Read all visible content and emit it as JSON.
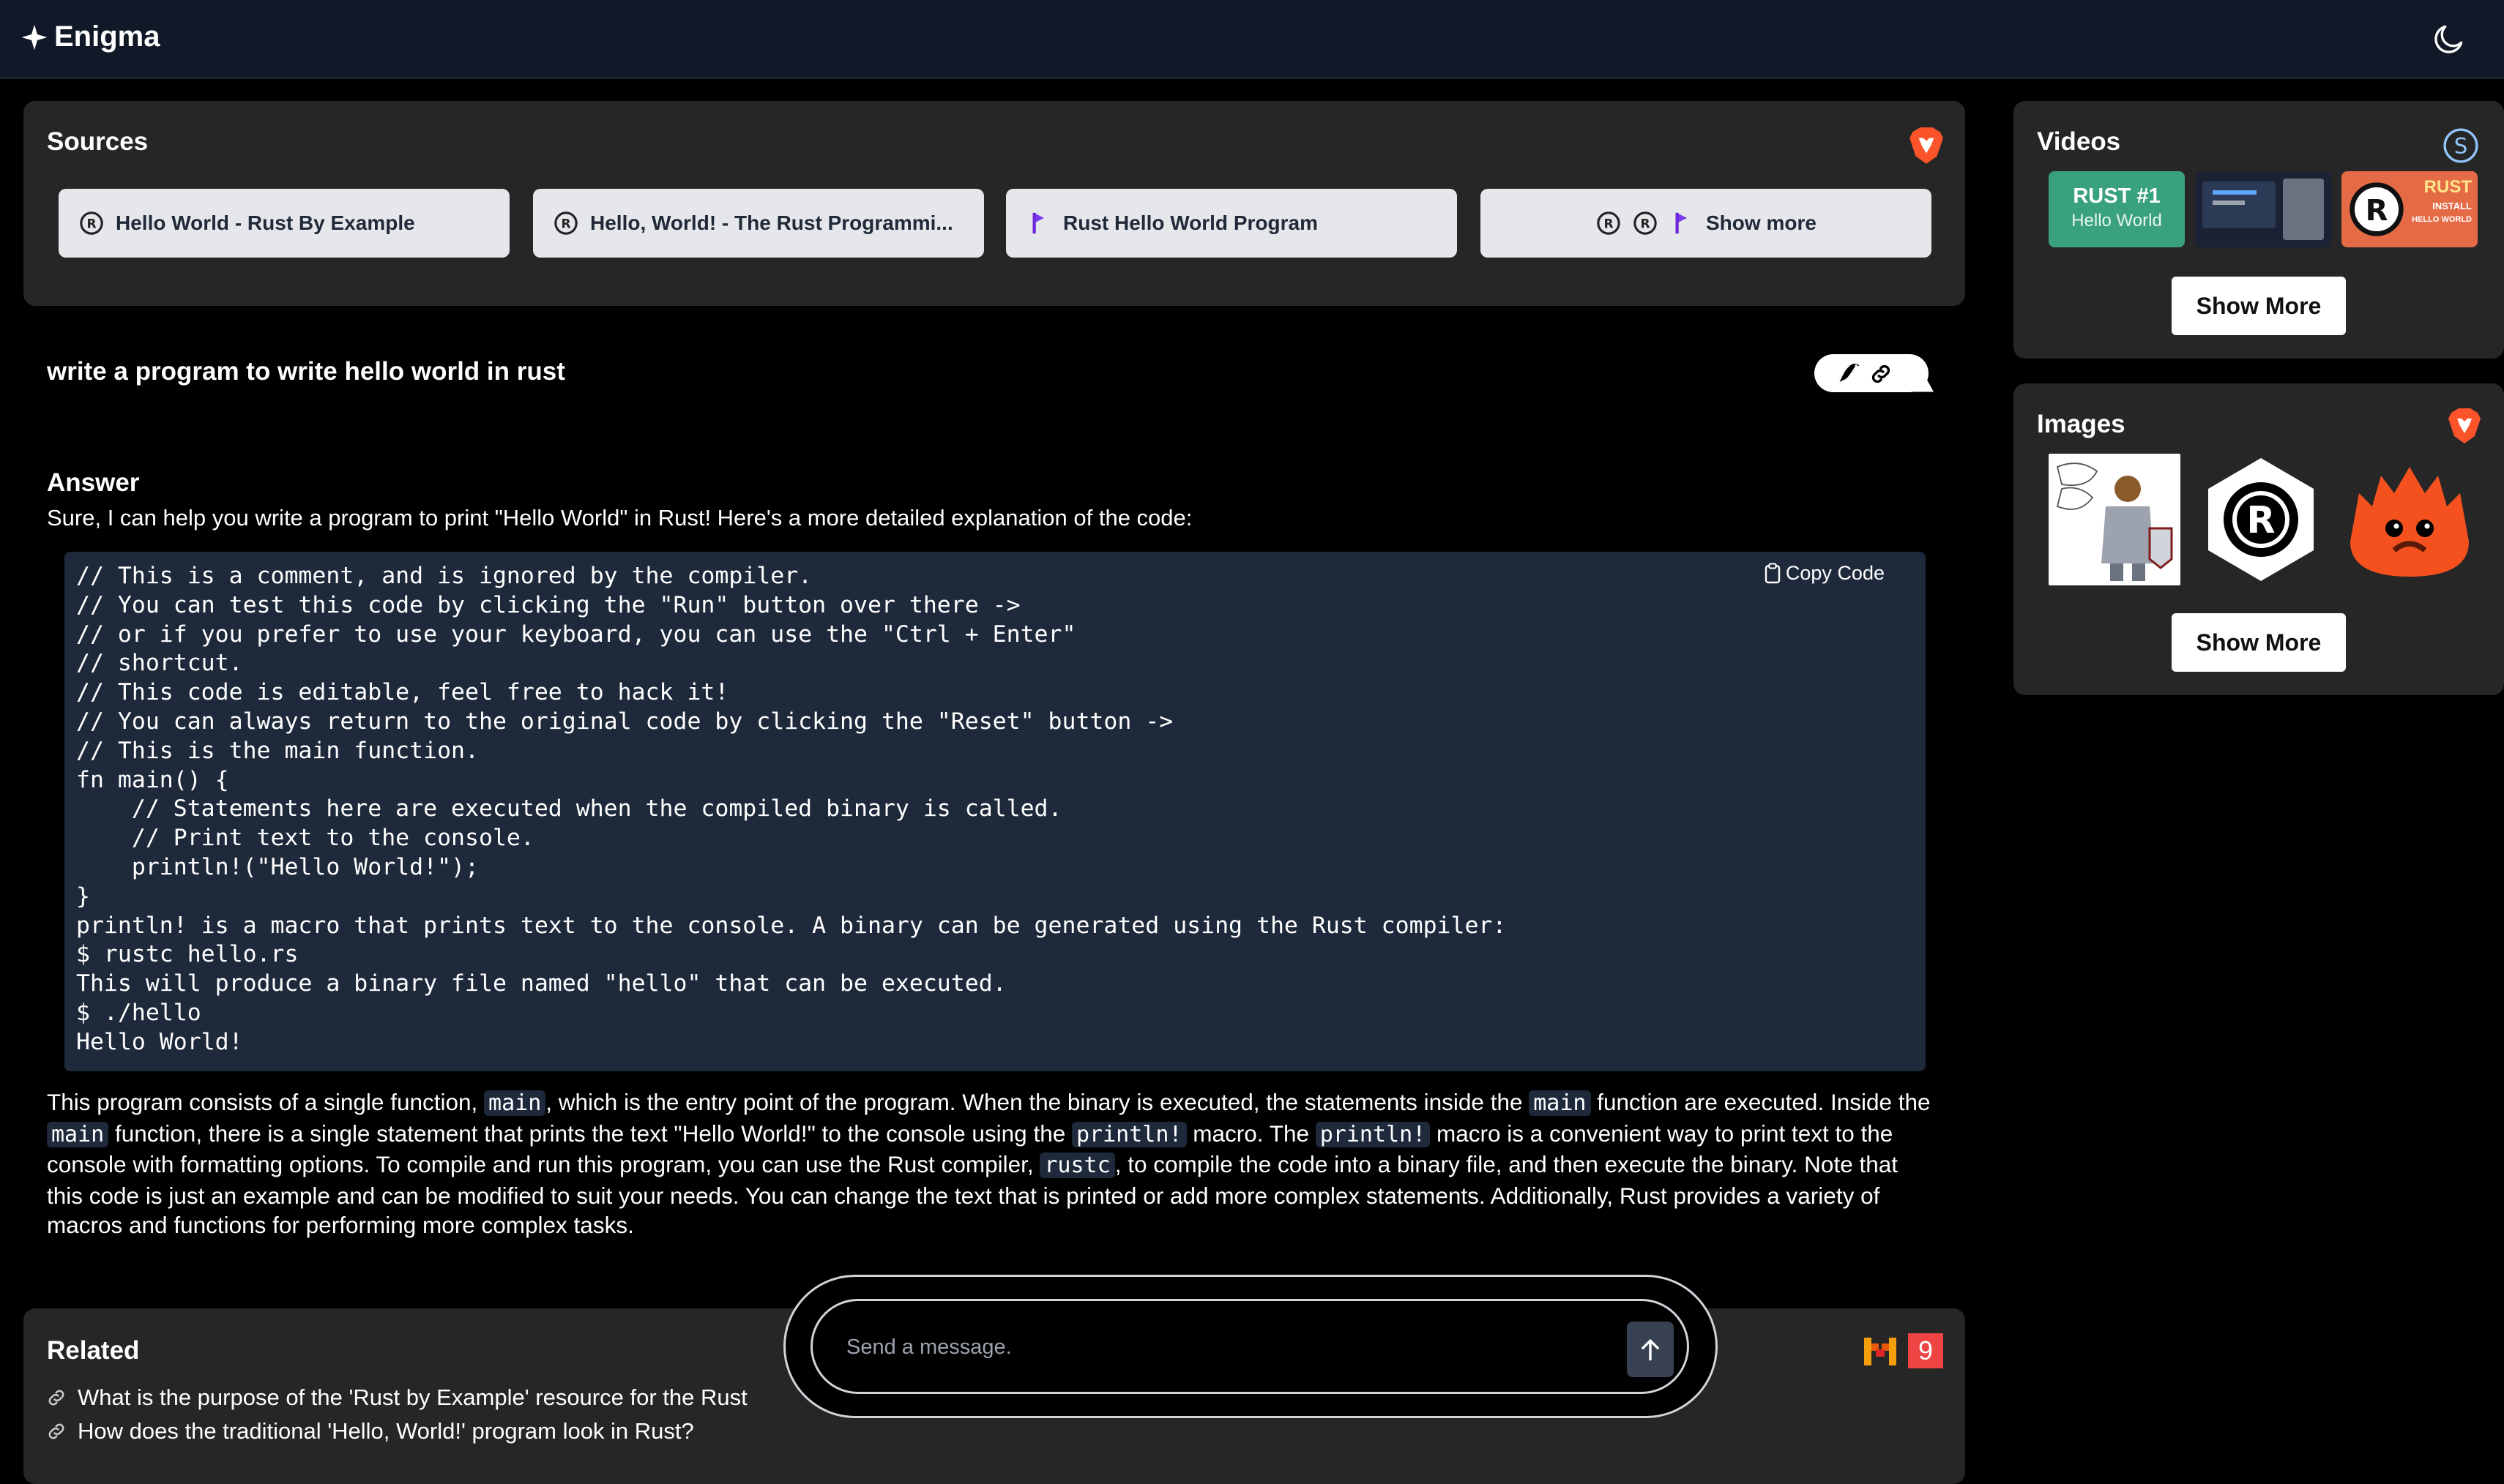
{
  "app": {
    "title": "Enigma"
  },
  "sources": {
    "title": "Sources",
    "items": [
      {
        "label": "Hello World - Rust By Example",
        "icon": "rust-logo-icon"
      },
      {
        "label": "Hello, World! - The Rust Programmi...",
        "icon": "rust-logo-icon"
      },
      {
        "label": "Rust Hello World Program",
        "icon": "perplexity-logo-icon"
      }
    ],
    "show_more": "Show more"
  },
  "question": "write a program to write hello world in rust",
  "answer": {
    "heading": "Answer",
    "intro": "Sure, I can help you write a program to print \"Hello World\" in Rust! Here's a more detailed explanation of the code:",
    "copy_label": "Copy Code",
    "code": "// This is a comment, and is ignored by the compiler.\n// You can test this code by clicking the \"Run\" button over there ->\n// or if you prefer to use your keyboard, you can use the \"Ctrl + Enter\"\n// shortcut.\n// This code is editable, feel free to hack it!\n// You can always return to the original code by clicking the \"Reset\" button ->\n// This is the main function.\nfn main() {\n    // Statements here are executed when the compiled binary is called.\n    // Print text to the console.\n    println!(\"Hello World!\");\n}\nprintln! is a macro that prints text to the console. A binary can be generated using the Rust compiler:\n$ rustc hello.rs\nThis will produce a binary file named \"hello\" that can be executed.\n$ ./hello\nHello World!",
    "explanation": [
      {
        "t": "This program consists of a single function, "
      },
      {
        "c": "main"
      },
      {
        "t": ", which is the entry point of the program. When the binary is executed, the statements inside the "
      },
      {
        "c": "main"
      },
      {
        "t": " function are executed. Inside the "
      },
      {
        "c": "main"
      },
      {
        "t": " function, there is a single statement that prints the text \"Hello World!\" to the console using the "
      },
      {
        "c": "println!"
      },
      {
        "t": " macro. The "
      },
      {
        "c": "println!"
      },
      {
        "t": " macro is a convenient way to print text to the console with formatting options. To compile and run this program, you can use the Rust compiler, "
      },
      {
        "c": "rustc"
      },
      {
        "t": ", to compile the code into a binary file, and then execute the binary. Note that this code is just an example and can be modified to suit your needs. You can change the text that is printed or add more complex statements. Additionally, Rust provides a variety of macros and functions for performing more complex tasks."
      }
    ]
  },
  "related": {
    "title": "Related",
    "items": [
      "What is the purpose of the 'Rust by Example' resource for the Rust",
      "How does the traditional 'Hello, World!' program look in Rust?"
    ],
    "badge_number": "9"
  },
  "composer": {
    "placeholder": "Send a message."
  },
  "videos": {
    "title": "Videos",
    "thumb1_title": "RUST #1",
    "thumb1_sub": "Hello World",
    "thumb3_title": "RUST",
    "thumb3_sub1": "INSTALL",
    "thumb3_sub2": "HELLO WORLD",
    "show_more": "Show More"
  },
  "images": {
    "title": "Images",
    "show_more": "Show More"
  },
  "colors": {
    "background": "#000000",
    "topbar": "#111827",
    "card": "#272626",
    "code_bg": "#1e293b",
    "brave_orange": "#fb542b",
    "source_button": "#e5e7eb"
  }
}
